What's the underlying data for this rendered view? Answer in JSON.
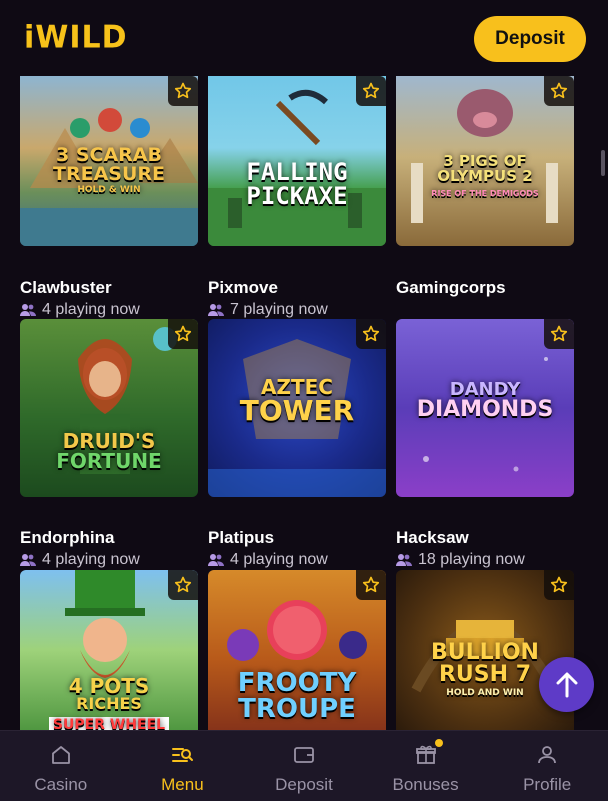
{
  "header": {
    "logo": "iWILD",
    "deposit_label": "Deposit"
  },
  "colors": {
    "brand": "#f8c01c",
    "background": "#0f0a14",
    "nav_background": "#1d1727",
    "scroll_top_button": "#5e3bc7"
  },
  "games": {
    "row1": [
      {
        "title_line1": "3 SCARAB",
        "title_line2": "TREASURE",
        "title_line3": "HOLD & WIN"
      },
      {
        "title_line1": "FALLING",
        "title_line2": "PICKAXE",
        "title_line3": ""
      },
      {
        "title_line1": "3 PIGS OF",
        "title_line2": "OLYMPUS 2",
        "title_line3": "RISE OF THE DEMIGODS"
      }
    ],
    "row2": [
      {
        "provider": "Clawbuster",
        "playing": "4 playing now",
        "title_line1": "DRUID'S",
        "title_line2": "FORTUNE"
      },
      {
        "provider": "Pixmove",
        "playing": "7 playing now",
        "title_line1": "AZTEC",
        "title_line2": "TOWER"
      },
      {
        "provider": "Gamingcorps",
        "playing": "",
        "title_line1": "DANDY",
        "title_line2": "DIAMONDS"
      }
    ],
    "row3": [
      {
        "provider": "Endorphina",
        "playing": "4 playing now",
        "title_line1": "4 POTS",
        "title_line2": "RICHES",
        "title_line3": "SUPER WHEEL"
      },
      {
        "provider": "Platipus",
        "playing": "4 playing now",
        "title_line1": "FROOTY",
        "title_line2": "TROUPE"
      },
      {
        "provider": "Hacksaw",
        "playing": "18 playing now",
        "title_line1": "BULLION",
        "title_line2": "RUSH 7",
        "title_line3": "HOLD AND WIN"
      }
    ]
  },
  "nav": {
    "casino": "Casino",
    "menu": "Menu",
    "deposit": "Deposit",
    "bonuses": "Bonuses",
    "profile": "Profile"
  },
  "icons": [
    "star-icon",
    "players-icon",
    "arrow-up-icon",
    "casino-home-icon",
    "menu-icon",
    "wallet-icon",
    "gift-icon",
    "user-icon"
  ]
}
